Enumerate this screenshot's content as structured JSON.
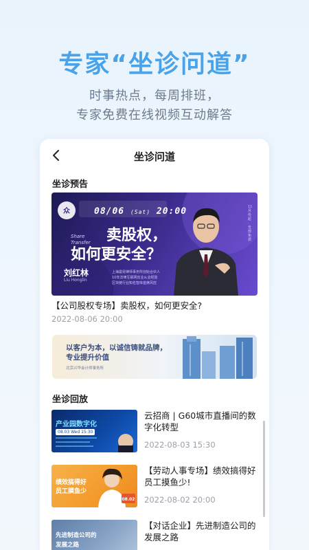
{
  "hero": {
    "title": "专家“坐诊问道”",
    "subtitle_line1": "时事热点，每周排班，",
    "subtitle_line2": "专家免费在线视频互动解答"
  },
  "nav": {
    "title": "坐诊问道",
    "back_icon": "chevron-left-icon"
  },
  "preview": {
    "section_title": "坐诊预告",
    "banner": {
      "date": "08/06",
      "weekday": "(Sat)",
      "time": "20:00",
      "tag": "Share Transfer",
      "headline1": "卖股权，",
      "headline2": "如何更安全？",
      "host_name": "刘红林",
      "host_name_en": "Liu Honglin",
      "host_desc1": "上海曼昆律师事务所创始合伙人",
      "host_desc2": "10年法律互联网创业从业经验",
      "host_desc3": "区块链行业知名智库首席风控",
      "side_text": "11月份起 · 全部免费"
    },
    "caption": "【公司股权专场】卖股权，如何更安全?",
    "time": "2022-08-06 20:00"
  },
  "ad": {
    "line1": "以客户为本，以诚信铸就品牌，",
    "line2": "专业提升价值",
    "org": "北京兴华会计师事务所"
  },
  "replay": {
    "section_title": "坐诊回放",
    "items": [
      {
        "title": "云招商 | G60城市直播间的数字化转型",
        "time": "2022-08-03 15:30",
        "thumb_title": "产业园数字化",
        "thumb_date": "08.03 Wed 15:30"
      },
      {
        "title": "【劳动人事专场】绩效搞得好 员工摸鱼少!",
        "time": "2022-08-02 20:00",
        "thumb_title": "绩效搞得好",
        "thumb_title2": "员工摸鱼少",
        "thumb_badge": "08.02"
      },
      {
        "title": "【对话企业】先进制造公司的发展之路",
        "time": "",
        "thumb_title": "先进制造公司的",
        "thumb_title2": "发展之路"
      }
    ]
  },
  "colors": {
    "hero_blue": "#4aa3e8",
    "banner_purple": "#3b2a8a",
    "accent_orange": "#f39a2c",
    "muted_gray": "#9aa0a8"
  }
}
